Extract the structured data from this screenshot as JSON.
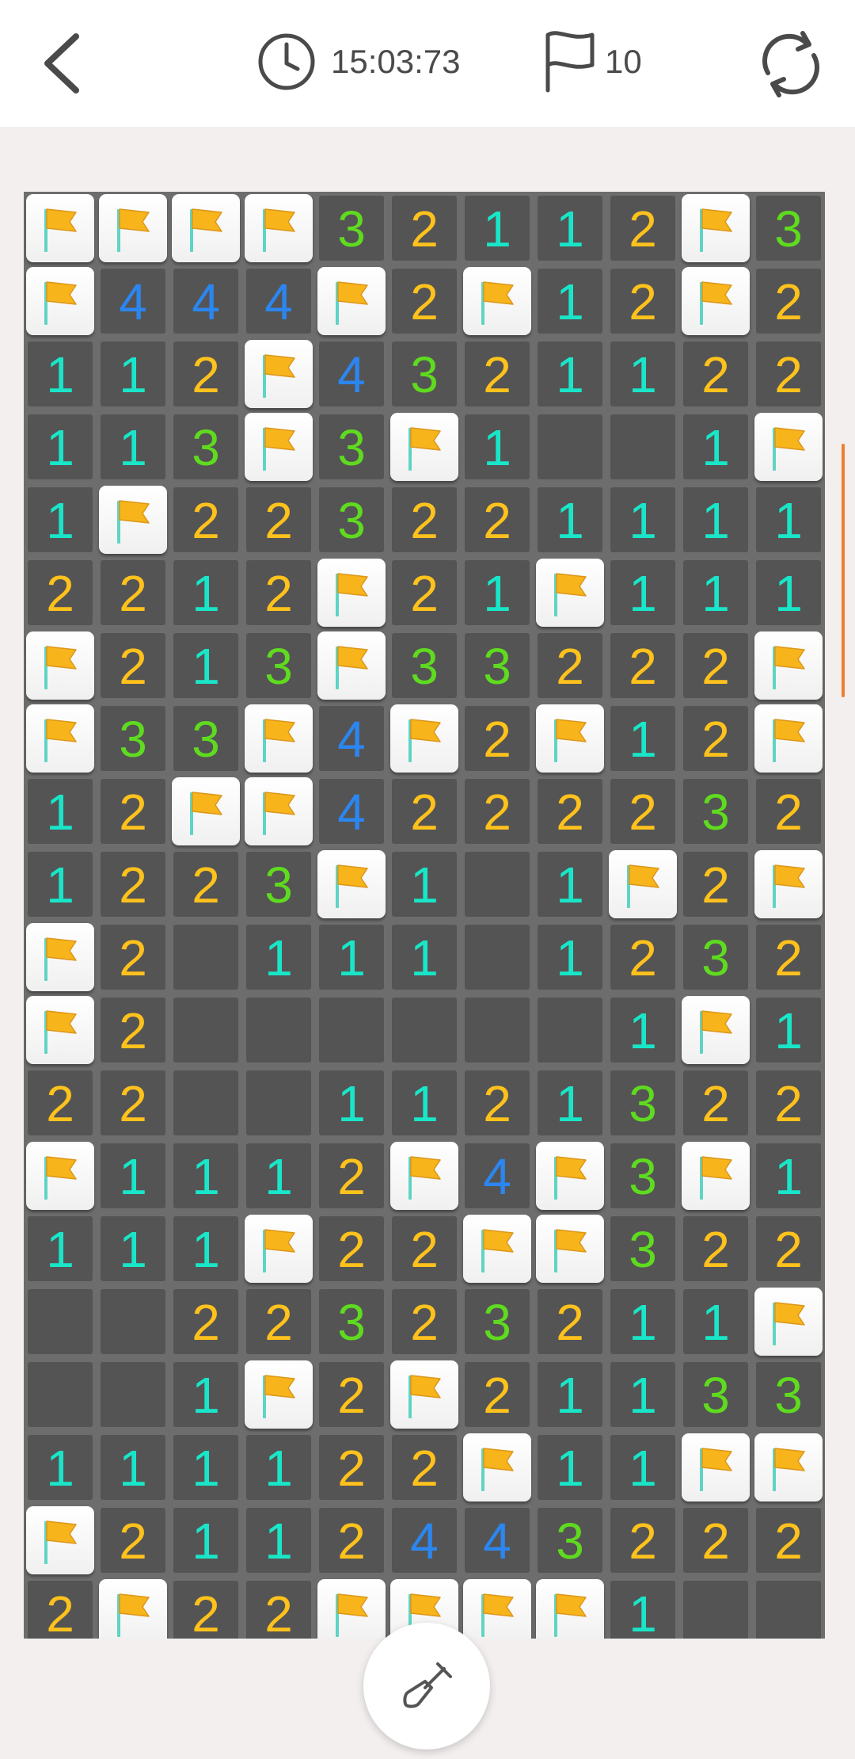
{
  "header": {
    "back_icon": "chevron-left-icon",
    "timer_icon": "clock-icon",
    "timer": "15:03:73",
    "flag_icon": "flag-icon",
    "flags_remaining": "10",
    "restart_icon": "refresh-icon"
  },
  "colors": {
    "number_1": "#19e6c8",
    "number_2": "#ffc21c",
    "number_3": "#5fdb1f",
    "number_4": "#2b86f0",
    "flag": "#f7b51b",
    "scrollbar": "#ef7f2e"
  },
  "board": {
    "columns": 11,
    "legend": "F = flagged tile, 0 = empty revealed tile, digit = adjacent mine count",
    "rows": [
      [
        "F",
        "F",
        "F",
        "F",
        "3",
        "2",
        "1",
        "1",
        "2",
        "F",
        "3"
      ],
      [
        "F",
        "4",
        "4",
        "4",
        "F",
        "2",
        "F",
        "1",
        "2",
        "F",
        "2"
      ],
      [
        "1",
        "1",
        "2",
        "F",
        "4",
        "3",
        "2",
        "1",
        "1",
        "2",
        "2"
      ],
      [
        "1",
        "1",
        "3",
        "F",
        "3",
        "F",
        "1",
        "0",
        "0",
        "1",
        "F"
      ],
      [
        "1",
        "F",
        "2",
        "2",
        "3",
        "2",
        "2",
        "1",
        "1",
        "1",
        "1"
      ],
      [
        "2",
        "2",
        "1",
        "2",
        "F",
        "2",
        "1",
        "F",
        "1",
        "1",
        "1"
      ],
      [
        "F",
        "2",
        "1",
        "3",
        "F",
        "3",
        "3",
        "2",
        "2",
        "2",
        "F"
      ],
      [
        "F",
        "3",
        "3",
        "F",
        "4",
        "F",
        "2",
        "F",
        "1",
        "2",
        "F"
      ],
      [
        "1",
        "2",
        "F",
        "F",
        "4",
        "2",
        "2",
        "2",
        "2",
        "3",
        "2"
      ],
      [
        "1",
        "2",
        "2",
        "3",
        "F",
        "1",
        "0",
        "1",
        "F",
        "2",
        "F"
      ],
      [
        "F",
        "2",
        "0",
        "1",
        "1",
        "1",
        "0",
        "1",
        "2",
        "3",
        "2"
      ],
      [
        "F",
        "2",
        "0",
        "0",
        "0",
        "0",
        "0",
        "0",
        "1",
        "F",
        "1"
      ],
      [
        "2",
        "2",
        "0",
        "0",
        "1",
        "1",
        "2",
        "1",
        "3",
        "2",
        "2"
      ],
      [
        "F",
        "1",
        "1",
        "1",
        "2",
        "F",
        "4",
        "F",
        "3",
        "F",
        "1"
      ],
      [
        "1",
        "1",
        "1",
        "F",
        "2",
        "2",
        "F",
        "F",
        "3",
        "2",
        "2"
      ],
      [
        "0",
        "0",
        "2",
        "2",
        "3",
        "2",
        "3",
        "2",
        "1",
        "1",
        "F"
      ],
      [
        "0",
        "0",
        "1",
        "F",
        "2",
        "F",
        "2",
        "1",
        "1",
        "3",
        "3"
      ],
      [
        "1",
        "1",
        "1",
        "1",
        "2",
        "2",
        "F",
        "1",
        "1",
        "F",
        "F"
      ],
      [
        "F",
        "2",
        "1",
        "1",
        "2",
        "4",
        "4",
        "3",
        "2",
        "2",
        "2"
      ],
      [
        "2",
        "F",
        "2",
        "2",
        "F",
        "F",
        "F",
        "F",
        "1",
        "0",
        "0"
      ]
    ]
  },
  "dig_button": {
    "icon": "shovel-icon"
  }
}
